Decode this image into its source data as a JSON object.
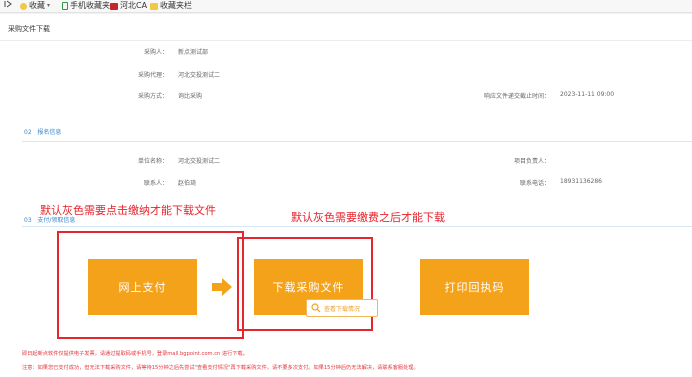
{
  "bookmarks": {
    "items": [
      {
        "label": "收藏",
        "icon": "star-icon"
      },
      {
        "label": "手机收藏夹",
        "icon": "phone-icon"
      },
      {
        "label": "河北CA",
        "icon": "ca-icon"
      },
      {
        "label": "收藏夹栏",
        "icon": "folder-icon"
      }
    ]
  },
  "panel": {
    "title": "采购文件下载"
  },
  "info": {
    "purchaser_label": "采购人：",
    "purchaser": "新点测试部",
    "agent_label": "采购代理：",
    "agent": "河北交投测试二",
    "method_label": "采购方式：",
    "method": "询比采购",
    "deadline_label": "响应文件递交截止时间：",
    "deadline": "2023-11-11 09:00"
  },
  "section2": {
    "number": "02",
    "title": "报名信息"
  },
  "signup": {
    "unit_label": "单位名称：",
    "unit": "河北交投测试二",
    "pm_label": "项目负责人：",
    "pm": "",
    "contact_label": "联系人：",
    "contact": "赵伯琦",
    "phone_label": "联系电话：",
    "phone": "18931136286"
  },
  "section3": {
    "number": "03",
    "title": "支付/领取信息"
  },
  "annotations": {
    "left": "默认灰色需要点击缴纳才能下载文件",
    "right": "默认灰色需要缴费之后才能下载"
  },
  "buttons": {
    "pay": "网上支付",
    "download": "下载采购文件",
    "print": "打印回执码"
  },
  "tooltip": {
    "label": "查看下载情况"
  },
  "notes": {
    "line1": "即日起新点软件仅提供电子发票，请通过提取码或手机号，登录mall.bgpoint.com.cn 进行下载。",
    "line2": "注意：如果您已支付成功，但无法下载采购文件，请等待15分钟之后先尝试\"查看支付情况\"再下载采购文件，请不要多次支付。如果15分钟后仍无法解决，请联系客服处理。"
  },
  "colors": {
    "accent": "#f5a21b",
    "annotation": "#e8212b",
    "section": "#3b86c9"
  }
}
